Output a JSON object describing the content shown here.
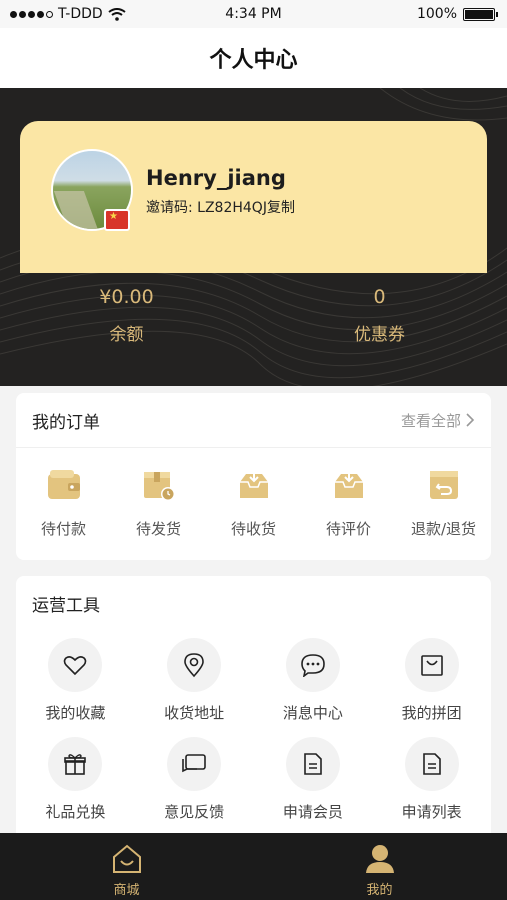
{
  "status_bar": {
    "carrier": "T-DDD",
    "time": "4:34 PM",
    "battery": "100%"
  },
  "nav": {
    "title": "个人中心"
  },
  "profile": {
    "username": "Henry_jiang",
    "invite_text": "邀请码: LZ82H4QJ复制"
  },
  "stats": [
    {
      "value": "¥0.00",
      "label": "余额"
    },
    {
      "value": "0",
      "label": "优惠券"
    }
  ],
  "orders": {
    "title": "我的订单",
    "view_all": "查看全部",
    "items": [
      {
        "label": "待付款",
        "icon": "wallet-icon"
      },
      {
        "label": "待发货",
        "icon": "package-clock-icon"
      },
      {
        "label": "待收货",
        "icon": "inbox-download-icon"
      },
      {
        "label": "待评价",
        "icon": "inbox-review-icon"
      },
      {
        "label": "退款/退货",
        "icon": "refund-return-icon"
      }
    ]
  },
  "tools": {
    "title": "运营工具",
    "items": [
      {
        "label": "我的收藏",
        "icon": "heart-icon"
      },
      {
        "label": "收货地址",
        "icon": "location-pin-icon"
      },
      {
        "label": "消息中心",
        "icon": "chat-bubble-icon"
      },
      {
        "label": "我的拼团",
        "icon": "shopping-bag-icon"
      },
      {
        "label": "礼品兑换",
        "icon": "gift-icon"
      },
      {
        "label": "意见反馈",
        "icon": "feedback-icon"
      },
      {
        "label": "申请会员",
        "icon": "document-icon"
      },
      {
        "label": "申请列表",
        "icon": "list-document-icon"
      }
    ]
  },
  "tabbar": [
    {
      "label": "商城",
      "icon": "home-store-icon"
    },
    {
      "label": "我的",
      "icon": "user-icon"
    }
  ],
  "colors": {
    "gold": "#d9b97a",
    "card": "#fbe6a5",
    "dark": "#232221"
  }
}
